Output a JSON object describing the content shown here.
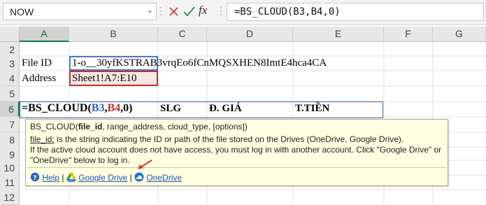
{
  "name_box": {
    "value": "NOW"
  },
  "formula_bar": {
    "formula": "=BS_CLOUD(B3,B4,0)",
    "fx_label": "fx"
  },
  "columns": [
    "A",
    "B",
    "C",
    "D",
    "E",
    "F",
    "G"
  ],
  "rows": [
    "2",
    "3",
    "4",
    "5",
    "6",
    "7",
    "8",
    "9",
    "10",
    "11",
    "12"
  ],
  "cells": {
    "a3": "File ID",
    "b3": "1-o__30yfKSTRAB3vrqEo6fCnMQSXHEN8ImtE4hca4CA",
    "a4": "Address",
    "b4": "Sheet1!A7:E10",
    "a6_prefix": "=BS_CLOUD(",
    "a6_b3": "B3",
    "a6_comma": ",",
    "a6_b4": "B4",
    "a6_suffix": ",0)",
    "c6": "SLG",
    "d6": "Đ. GIÁ",
    "e6": "T.TIỀN"
  },
  "tooltip": {
    "fn": "BS_CLOUD(",
    "arg1": "file_id",
    "rest": ", range_address, cloud_type, [options])",
    "param": "file_id:",
    "desc1": " is the string indicating the ID or path of the file stored on the Drives (OneDrive, Google Drive).",
    "desc2": "If the active cloud account does not have access, you must log in with another account. Click \"Google Drive\" or \"OneDrive\" below to log in.",
    "help": "Help",
    "sep": "|",
    "google": "Google Drive",
    "onedrive": "OneDrive"
  },
  "colors": {
    "accent_green": "#107c41",
    "ref_blue": "#4a78c8",
    "ref_red": "#c03030",
    "tooltip_bg": "#ffffe1"
  }
}
